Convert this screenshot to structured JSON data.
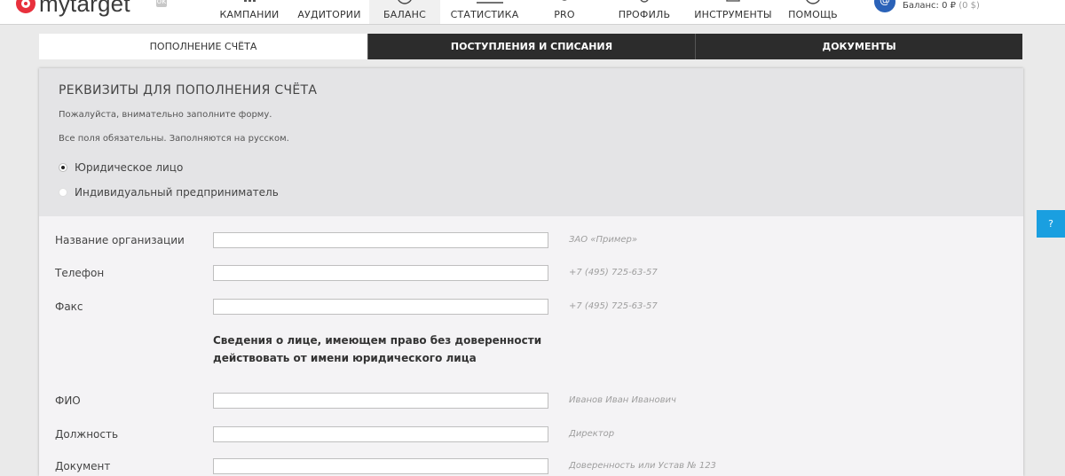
{
  "logo": {
    "text": "mytarget",
    "badge": "ok"
  },
  "nav": [
    {
      "label": "КАМПАНИИ",
      "icon": "campaigns-icon"
    },
    {
      "label": "АУДИТОРИИ",
      "icon": "audiences-icon"
    },
    {
      "label": "БАЛАНС",
      "icon": "balance-icon",
      "active": true
    },
    {
      "label": "СТАТИСТИКА",
      "icon": "statistics-icon"
    },
    {
      "label": "PRO",
      "icon": "pro-icon"
    },
    {
      "label": "ПРОФИЛЬ",
      "icon": "profile-icon"
    },
    {
      "label": "ИНСТРУМЕНТЫ",
      "icon": "tools-icon"
    },
    {
      "label": "ПОМОЩЬ",
      "icon": "help-icon"
    }
  ],
  "account": {
    "balance_label": "Баланс: 0 ₽",
    "balance_sub": "(0 $)"
  },
  "tabs": [
    {
      "label": "ПОПОЛНЕНИЕ СЧЁТА",
      "active": true
    },
    {
      "label": "ПОСТУПЛЕНИЯ И СПИСАНИЯ"
    },
    {
      "label": "ДОКУМЕНТЫ"
    }
  ],
  "form": {
    "title": "РЕКВИЗИТЫ ДЛЯ ПОПОЛНЕНИЯ СЧЁТА",
    "hint1": "Пожалуйста, внимательно заполните форму.",
    "hint2": "Все поля обязательны. Заполняются на русском.",
    "radios": [
      {
        "label": "Юридическое лицо",
        "checked": true
      },
      {
        "label": "Индивидуальный предприниматель",
        "checked": false
      }
    ],
    "fields": [
      {
        "label": "Название организации",
        "value": "",
        "example": "ЗАО «Пример»"
      },
      {
        "label": "Телефон",
        "value": "",
        "example": "+7 (495) 725-63-57"
      },
      {
        "label": "Факс",
        "value": "",
        "example": "+7 (495) 725-63-57"
      }
    ],
    "section_note_line1": "Сведения о лице, имеющем право без доверенности",
    "section_note_line2": "действовать от имени юридического лица",
    "person_fields": [
      {
        "label": "ФИО",
        "value": "",
        "example": "Иванов Иван Иванович"
      },
      {
        "label": "Должность",
        "value": "",
        "example": "Директор"
      },
      {
        "label": "Документ",
        "value": "",
        "example": "Доверенность или Устав № 123"
      }
    ]
  },
  "help_button": {
    "label": "?"
  }
}
